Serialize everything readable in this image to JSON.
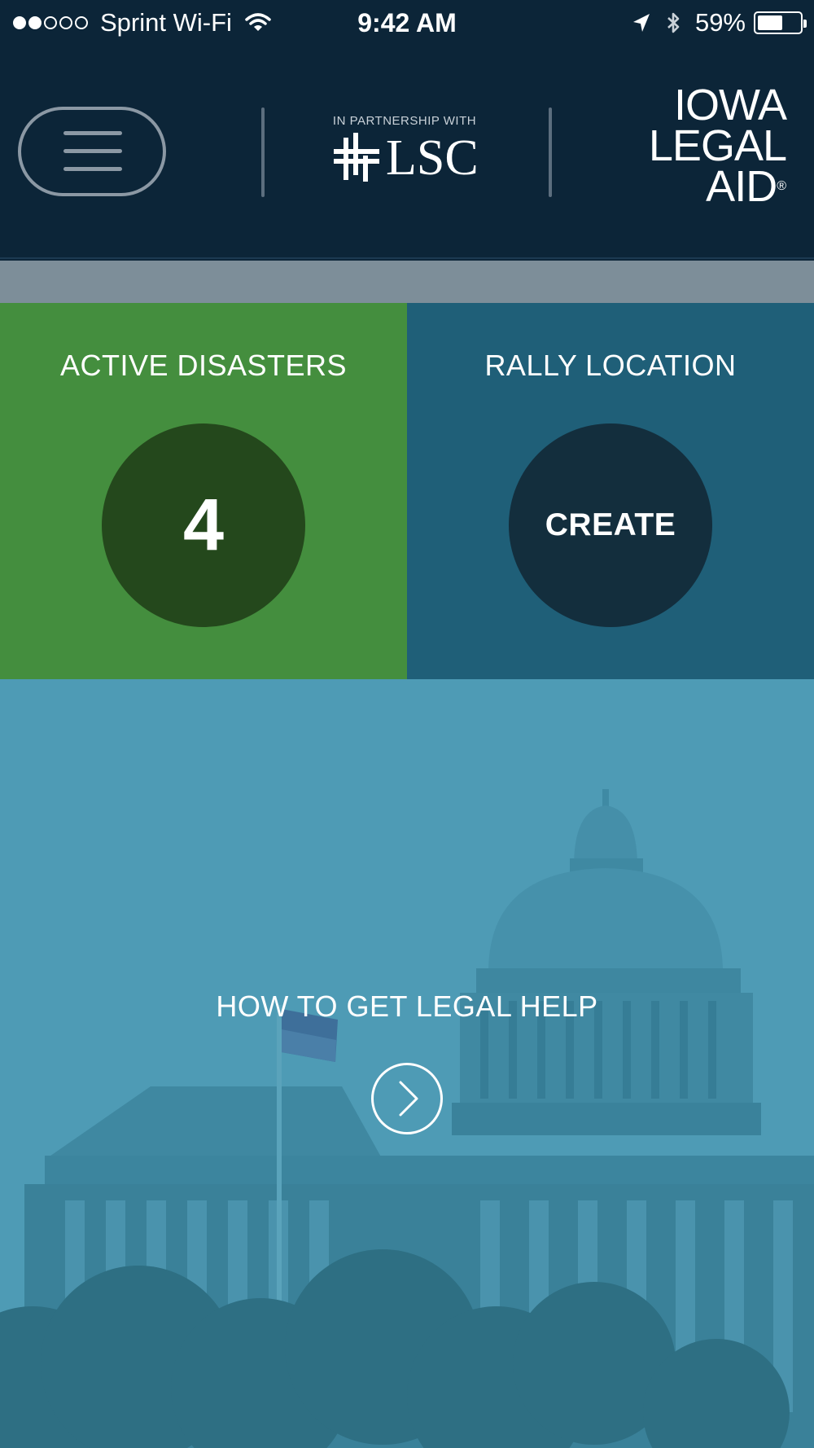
{
  "status_bar": {
    "carrier": "Sprint Wi-Fi",
    "time": "9:42 AM",
    "battery_percent": "59%",
    "battery_level": 0.59,
    "signal_dots": [
      true,
      true,
      false,
      false,
      false
    ],
    "icons": [
      "wifi-icon",
      "location-arrow-icon",
      "bluetooth-icon",
      "battery-icon"
    ]
  },
  "header": {
    "menu_icon": "hamburger-menu-icon",
    "partner_caption": "IN PARTNERSHIP WITH",
    "partner_logo_text": "LSC",
    "org_logo_lines": [
      "IOWA",
      "LEGAL",
      "AID"
    ],
    "org_logo_registered": "®"
  },
  "tiles": {
    "active_disasters": {
      "title": "ACTIVE DISASTERS",
      "count": "4"
    },
    "rally_location": {
      "title": "RALLY LOCATION",
      "action_label": "CREATE"
    }
  },
  "hero": {
    "title": "HOW TO GET LEGAL HELP",
    "button_icon": "chevron-right-icon"
  },
  "colors": {
    "header_bg": "#0c2538",
    "strip": "#7d8e99",
    "disasters_tile": "#448e3e",
    "disasters_circle": "#24481c",
    "rally_tile": "#1f5f78",
    "rally_circle": "#132e3d",
    "hero_overlay": "#4e9bb5"
  }
}
